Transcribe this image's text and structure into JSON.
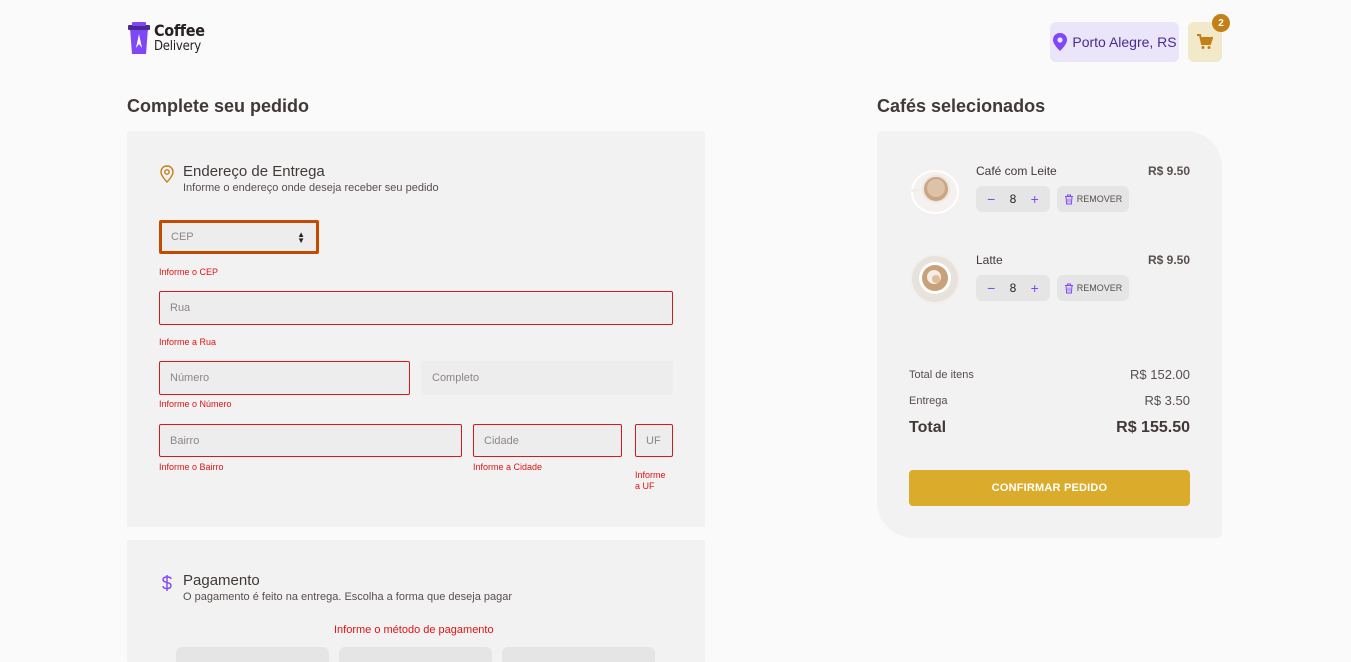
{
  "brand": {
    "line1": "Coffee",
    "line2": "Delivery",
    "color": "#8047f8"
  },
  "header": {
    "location": "Porto Alegre, RS",
    "cart_count": "2"
  },
  "checkout": {
    "title": "Complete seu pedido",
    "address": {
      "title": "Endereço de Entrega",
      "subtitle": "Informe o endereço onde deseja receber seu pedido",
      "fields": {
        "cep": {
          "placeholder": "CEP",
          "error": "Informe o CEP"
        },
        "rua": {
          "placeholder": "Rua",
          "error": "Informe a Rua"
        },
        "numero": {
          "placeholder": "Número",
          "error": "Informe o Número"
        },
        "complemento": {
          "placeholder": "Completo"
        },
        "bairro": {
          "placeholder": "Bairro",
          "error": "Informe o Bairro"
        },
        "cidade": {
          "placeholder": "Cidade",
          "error": "Informe a Cidade"
        },
        "uf": {
          "placeholder": "UF",
          "error_line1": "Informe",
          "error_line2": "a UF"
        }
      }
    },
    "payment": {
      "title": "Pagamento",
      "subtitle": "O pagamento é feito na entrega. Escolha a forma que deseja pagar",
      "error": "Informe o método de pagamento"
    }
  },
  "cart": {
    "title": "Cafés selecionados",
    "items": [
      {
        "name": "Café com Leite",
        "price": "R$ 9.50",
        "qty": "8",
        "remove": "REMOVER"
      },
      {
        "name": "Latte",
        "price": "R$ 9.50",
        "qty": "8",
        "remove": "REMOVER"
      }
    ],
    "summary": {
      "items_label": "Total de itens",
      "items_value": "R$ 152.00",
      "delivery_label": "Entrega",
      "delivery_value": "R$ 3.50",
      "total_label": "Total",
      "total_value": "R$ 155.50"
    },
    "confirm": "CONFIRMAR PEDIDO"
  },
  "colors": {
    "error": "#e01414",
    "accent": "#8047f8",
    "yellow": "#dbac2c",
    "yellow_dark": "#c47f17"
  }
}
